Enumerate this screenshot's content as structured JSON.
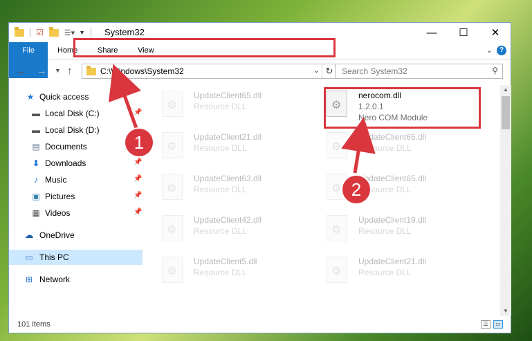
{
  "window": {
    "title": "System32",
    "controls": {
      "minimize": "—",
      "maximize": "☐",
      "close": "✕"
    }
  },
  "ribbon": {
    "tabs": [
      "File",
      "Home",
      "Share",
      "View"
    ],
    "help": "?"
  },
  "address_bar": {
    "path": "C:\\Windows\\System32",
    "search_placeholder": "Search System32"
  },
  "sidebar": {
    "items": [
      {
        "label": "Quick access",
        "icon": "star-icon",
        "pinned": false
      },
      {
        "label": "Local Disk (C:)",
        "icon": "drive-icon",
        "pinned": true
      },
      {
        "label": "Local Disk (D:)",
        "icon": "drive-icon",
        "pinned": false
      },
      {
        "label": "Documents",
        "icon": "documents-icon",
        "pinned": true
      },
      {
        "label": "Downloads",
        "icon": "download-icon",
        "pinned": true
      },
      {
        "label": "Music",
        "icon": "music-icon",
        "pinned": true
      },
      {
        "label": "Pictures",
        "icon": "pictures-icon",
        "pinned": true
      },
      {
        "label": "Videos",
        "icon": "videos-icon",
        "pinned": true
      },
      {
        "label": "OneDrive",
        "icon": "cloud-icon",
        "pinned": false
      },
      {
        "label": "This PC",
        "icon": "computer-icon",
        "pinned": false,
        "selected": true
      },
      {
        "label": "Network",
        "icon": "network-icon",
        "pinned": false
      }
    ]
  },
  "files": {
    "highlighted": {
      "name": "nerocom.dll",
      "version": "1.2.0.1",
      "description": "Nero COM Module"
    },
    "left_column": [
      {
        "name": "UpdateClient65.dll",
        "type": "Resource DLL"
      },
      {
        "name": "UpdateClient21.dll",
        "type": "Resource DLL"
      },
      {
        "name": "UpdateClient63.dll",
        "type": "Resource DLL"
      },
      {
        "name": "UpdateClient42.dll",
        "type": "Resource DLL"
      },
      {
        "name": "UpdateClient5.dll",
        "type": "Resource DLL"
      }
    ],
    "right_column": [
      {
        "name": "UpdateClient65.dll",
        "type": "Resource DLL"
      },
      {
        "name": "UpdateClient65.dll",
        "type": "Resource DLL"
      },
      {
        "name": "UpdateClient19.dll",
        "type": "Resource DLL"
      },
      {
        "name": "UpdateClient21.dll",
        "type": "Resource DLL"
      }
    ]
  },
  "status_bar": {
    "item_count": "101 items"
  },
  "annotations": {
    "step1": "1",
    "step2": "2",
    "highlight_color": "#d9363e"
  }
}
